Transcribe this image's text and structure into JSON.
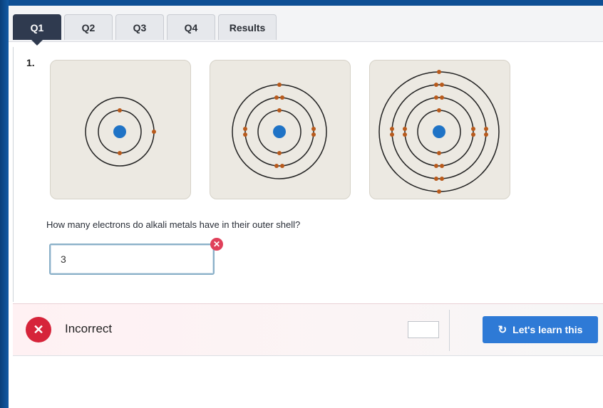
{
  "tabs": [
    {
      "label": "Q1",
      "active": true
    },
    {
      "label": "Q2",
      "active": false
    },
    {
      "label": "Q3",
      "active": false
    },
    {
      "label": "Q4",
      "active": false
    },
    {
      "label": "Results",
      "active": false
    }
  ],
  "question": {
    "number": "1.",
    "text": "How many electrons do alkali metals have in their outer shell?",
    "answer_value": "3",
    "error_badge_icon": "close-icon"
  },
  "atoms": [
    {
      "shells": 2
    },
    {
      "shells": 3
    },
    {
      "shells": 4
    }
  ],
  "feedback": {
    "status_icon": "close-icon",
    "status_text": "Incorrect",
    "learn_button_icon": "refresh-icon",
    "learn_button_label": "Let's learn this"
  },
  "colors": {
    "active_tab": "#2f3a4f",
    "nucleus": "#1f73c6",
    "electron": "#b85a1c",
    "incorrect": "#d6243a",
    "button": "#2e7ad6"
  }
}
